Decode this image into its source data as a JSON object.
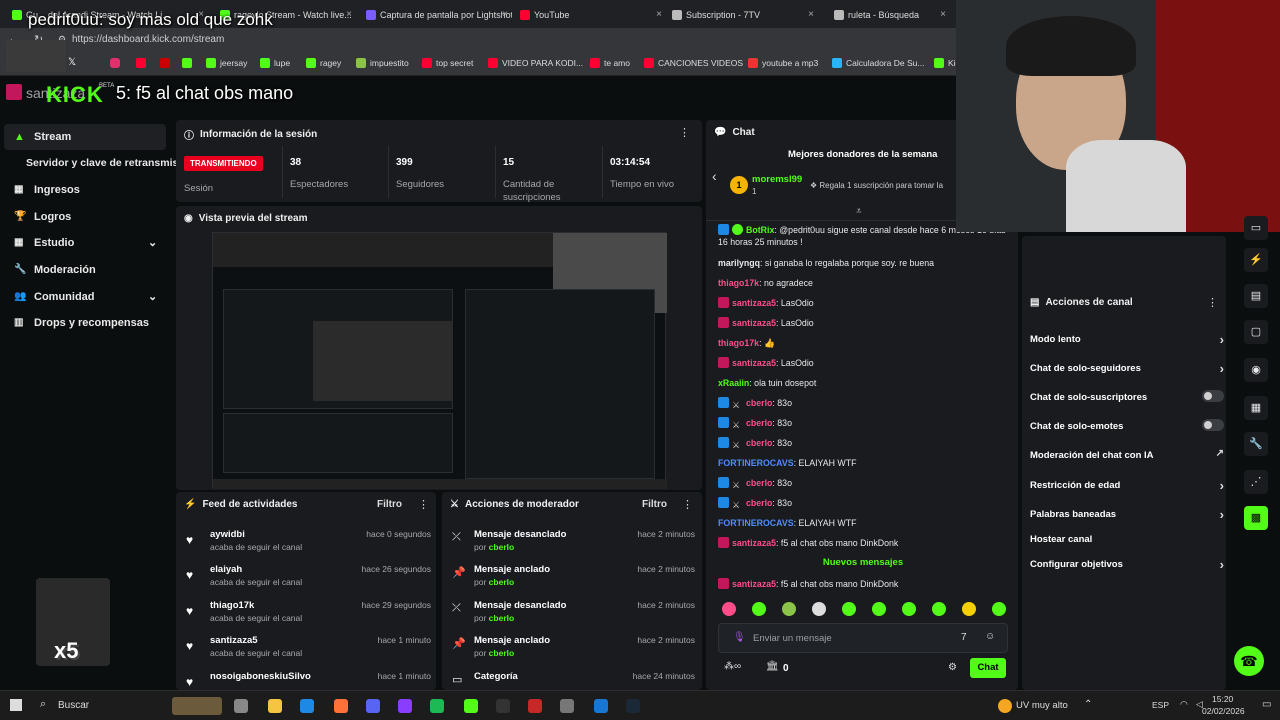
{
  "browser": {
    "tabs": [
      {
        "label": "Gu... del Arandi Stream - Watch Li...",
        "color": "#53fc18"
      },
      {
        "label": "rageylo Stream - Watch live...",
        "color": "#53fc18"
      },
      {
        "label": "Captura de pantalla por Lightshot",
        "color": "#7a5cff"
      },
      {
        "label": "YouTube",
        "color": "#ff0033"
      },
      {
        "label": "Subscription - 7TV",
        "color": "#bbbbbb"
      },
      {
        "label": "ruleta - Búsqueda",
        "color": "#bbbbbb"
      }
    ],
    "url": "https://dashboard.kick.com/stream",
    "bookmarks": [
      {
        "label": "jeersay",
        "color": "#53fc18"
      },
      {
        "label": "lupe",
        "color": "#53fc18"
      },
      {
        "label": "ragey",
        "color": "#53fc18"
      },
      {
        "label": "impuestito",
        "color": "#8bc34a"
      },
      {
        "label": "top secret",
        "color": "#ff0033"
      },
      {
        "label": "VIDEO PARA KODI...",
        "color": "#ff0033"
      },
      {
        "label": "te amo",
        "color": "#ff0033"
      },
      {
        "label": "CANCIONES VIDEOS",
        "color": "#ff0033"
      },
      {
        "label": "youtube a mp3",
        "color": "#e33"
      },
      {
        "label": "Calculadora De Su...",
        "color": "#29b6f6"
      },
      {
        "label": "Kic",
        "color": "#53fc18"
      }
    ]
  },
  "overlay": {
    "top_message": "pedrit0uu: soy mas old que zohk",
    "mid_message": "5: f5 al chat obs mano",
    "mid_user": "santizaza",
    "logo": "KICK",
    "beta": "BETA",
    "multiplier": "x5"
  },
  "sidebar": {
    "items": [
      {
        "label": "Stream",
        "icon": "stream-icon"
      },
      {
        "label": "Servidor y clave de retransmisión",
        "icon": ""
      },
      {
        "label": "Ingresos",
        "icon": "dollar-icon"
      },
      {
        "label": "Logros",
        "icon": "trophy-icon"
      },
      {
        "label": "Estudio",
        "icon": "grid-icon"
      },
      {
        "label": "Moderación",
        "icon": "wrench-icon"
      },
      {
        "label": "Comunidad",
        "icon": "users-icon"
      },
      {
        "label": "Drops y recompensas",
        "icon": "gift-icon"
      }
    ]
  },
  "session": {
    "title": "Información de la sesión",
    "status_badge": "TRANSMITIENDO",
    "status_label": "Sesión",
    "stats": [
      {
        "value": "38",
        "label": "Espectadores"
      },
      {
        "value": "399",
        "label": "Seguidores"
      },
      {
        "value": "15",
        "label": "Cantidad de suscripciones"
      },
      {
        "value": "03:14:54",
        "label": "Tiempo en vivo"
      }
    ]
  },
  "preview": {
    "title": "Vista previa del stream"
  },
  "feed": {
    "title": "Feed de actividades",
    "filter": "Filtro",
    "items": [
      {
        "user": "aywidbi",
        "sub": "acaba de seguir el canal",
        "time": "hace 0 segundos"
      },
      {
        "user": "elaiyah",
        "sub": "acaba de seguir el canal",
        "time": "hace 26 segundos"
      },
      {
        "user": "thiago17k",
        "sub": "acaba de seguir el canal",
        "time": "hace 29 segundos"
      },
      {
        "user": "santizaza5",
        "sub": "acaba de seguir el canal",
        "time": "hace 1 minuto"
      },
      {
        "user": "nosoigaboneskiuSilvo",
        "sub": "",
        "time": "hace 1 minuto"
      }
    ]
  },
  "mod_actions": {
    "title": "Acciones de moderador",
    "filter": "Filtro",
    "by_prefix": "por",
    "items": [
      {
        "action": "Mensaje desanclado",
        "by": "cberlo",
        "time": "hace 2 minutos",
        "icon": "unpin-icon"
      },
      {
        "action": "Mensaje anclado",
        "by": "cberlo",
        "time": "hace 2 minutos",
        "icon": "pin-icon"
      },
      {
        "action": "Mensaje desanclado",
        "by": "cberlo",
        "time": "hace 2 minutos",
        "icon": "unpin-icon"
      },
      {
        "action": "Mensaje anclado",
        "by": "cberlo",
        "time": "hace 2 minutos",
        "icon": "pin-icon"
      },
      {
        "action": "Categoría",
        "by": "",
        "time": "hace 24 minutos",
        "icon": "category-icon"
      }
    ]
  },
  "chat": {
    "title": "Chat",
    "leaderboard_title": "Mejores donadores de la semana",
    "top_user": "moremsl99",
    "top_rank": "1",
    "top_count": "1",
    "gift_text": "Regala 1 suscripción para tomar la",
    "messages": [
      {
        "user": "BotRix",
        "color": "#53fc18",
        "text": ": @pedrit0uu sigue este canal desde hace 6 meses 16 días 16 horas 25 minutos !"
      },
      {
        "user": "marilyngq",
        "color": "#e8e8e8",
        "text": ": si ganaba lo regalaba porque soy. re buena"
      },
      {
        "user": "thiago17k",
        "color": "#ff4d8a",
        "text": ": no agradece"
      },
      {
        "user": "santizaza5",
        "color": "#ff4d8a",
        "text": ": LasOdio"
      },
      {
        "user": "santizaza5",
        "color": "#ff4d8a",
        "text": ": LasOdio"
      },
      {
        "user": "thiago17k",
        "color": "#ff4d8a",
        "text": ": 👍"
      },
      {
        "user": "santizaza5",
        "color": "#ff4d8a",
        "text": ": LasOdio"
      },
      {
        "user": "xRaaiin",
        "color": "#53fc18",
        "text": ": ola tuin dosepot"
      },
      {
        "user": "cberlo",
        "color": "#ff4d8a",
        "text": ": 83o"
      },
      {
        "user": "cberlo",
        "color": "#ff4d8a",
        "text": ": 83o"
      },
      {
        "user": "cberlo",
        "color": "#ff4d8a",
        "text": ": 83o"
      },
      {
        "user": "FORTINEROCAVS",
        "color": "#4f8cff",
        "text": ": ELAIYAH WTF"
      },
      {
        "user": "cberlo",
        "color": "#ff4d8a",
        "text": ": 83o"
      },
      {
        "user": "cberlo",
        "color": "#ff4d8a",
        "text": ": 83o"
      },
      {
        "user": "FORTINEROCAVS",
        "color": "#4f8cff",
        "text": ": ELAIYAH WTF"
      },
      {
        "user": "santizaza5",
        "color": "#ff4d8a",
        "text": ": f5 al chat obs mano DinkDonk"
      }
    ],
    "new_messages_label": "Nuevos mensajes",
    "last_message": {
      "user": "santizaza5",
      "text": ": f5 al chat obs mano DinkDonk"
    },
    "input_placeholder": "Enviar un mensaje",
    "points": "0",
    "send_label": "Chat"
  },
  "channel_actions": {
    "title": "Acciones de canal",
    "items": [
      {
        "label": "Modo lento",
        "control": "chevron"
      },
      {
        "label": "Chat de solo-seguidores",
        "control": "chevron"
      },
      {
        "label": "Chat de solo-suscriptores",
        "control": "toggle"
      },
      {
        "label": "Chat de solo-emotes",
        "control": "toggle"
      },
      {
        "label": "Moderación del chat con IA",
        "control": "external"
      },
      {
        "label": "Restricción de edad",
        "control": "chevron"
      },
      {
        "label": "Palabras baneadas",
        "control": "chevron"
      },
      {
        "label": "Hostear canal",
        "control": "none"
      },
      {
        "label": "Configurar objetivos",
        "control": "chevron"
      }
    ]
  },
  "taskbar": {
    "search_placeholder": "Buscar",
    "weather": "UV muy alto",
    "lang": "ESP",
    "time": "15:20",
    "date": "02/02/2026"
  }
}
